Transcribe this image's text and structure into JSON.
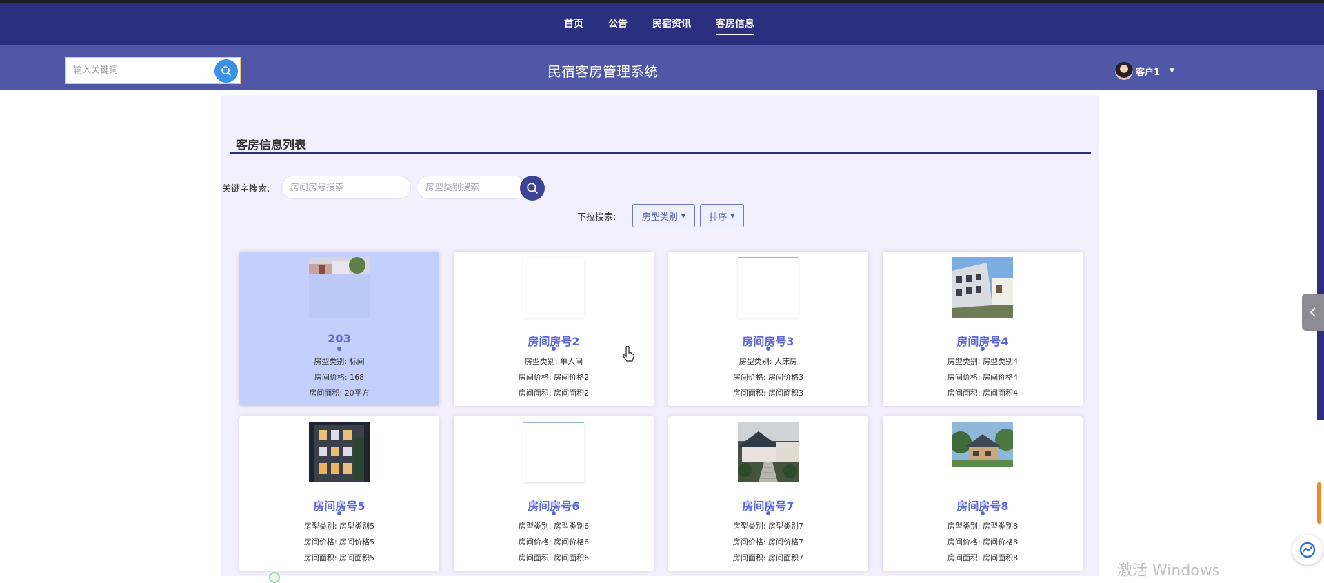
{
  "nav": {
    "items": [
      {
        "label": "首页"
      },
      {
        "label": "公告"
      },
      {
        "label": "民宿资讯"
      },
      {
        "label": "客房信息",
        "active": true
      }
    ]
  },
  "header": {
    "search_placeholder": "输入关键词",
    "site_title": "民宿客房管理系统",
    "user_name": "客户1"
  },
  "section": {
    "title": "客房信息列表"
  },
  "filters": {
    "keyword_label": "关键字搜索:",
    "room_number_placeholder": "房间房号搜索",
    "room_type_placeholder": "房型类别搜索",
    "dropdown_label": "下拉搜索:",
    "room_type_dropdown": "房型类别",
    "sort_dropdown": "排序"
  },
  "rooms": [
    {
      "title": "203",
      "type_line": "房型类别: 标间",
      "price_line": "房间价格: 168",
      "area_line": "房间面积: 20平方",
      "image": "partial-photo",
      "selected": true
    },
    {
      "title": "房间房号2",
      "type_line": "房型类别: 单人间",
      "price_line": "房间价格: 房间价格2",
      "area_line": "房间面积: 房间面积2",
      "image": "blank"
    },
    {
      "title": "房间房号3",
      "type_line": "房型类别: 大床房",
      "price_line": "房间价格: 房间价格3",
      "area_line": "房间面积: 房间面积3",
      "image": "blank"
    },
    {
      "title": "房间房号4",
      "type_line": "房型类别: 房型类别4",
      "price_line": "房间价格: 房间价格4",
      "area_line": "房间面积: 房间面积4",
      "image": "building-photo"
    },
    {
      "title": "房间房号5",
      "type_line": "房型类别: 房型类别5",
      "price_line": "房间价格: 房间价格5",
      "area_line": "房间面积: 房间面积5",
      "image": "night-building-photo"
    },
    {
      "title": "房间房号6",
      "type_line": "房型类别: 房型类别6",
      "price_line": "房间价格: 房间价格6",
      "area_line": "房间面积: 房间面积6",
      "image": "blank"
    },
    {
      "title": "房间房号7",
      "type_line": "房型类别: 房型类别7",
      "price_line": "房间价格: 房间价格7",
      "area_line": "房间面积: 房间面积7",
      "image": "courtyard-photo"
    },
    {
      "title": "房间房号8",
      "type_line": "房型类别: 房型类别8",
      "price_line": "房间价格: 房间价格8",
      "area_line": "房间面积: 房间面积8",
      "image": "villa-photo"
    }
  ],
  "system": {
    "watermark": "激活 Windows"
  },
  "colors": {
    "nav_bg": "#2c2f80",
    "header_bg": "#5157a7",
    "main_bg": "#f1f0fc",
    "accent_blue": "#3a92e8",
    "title_blue": "#5b66d8",
    "selected_card": "#c3d0fb"
  },
  "icons": {
    "header_search": "search-icon",
    "filter_search": "search-icon",
    "user_caret": "caret-down-icon",
    "side_tab": "chevron-left-icon",
    "float_button": "assistant-icon"
  }
}
